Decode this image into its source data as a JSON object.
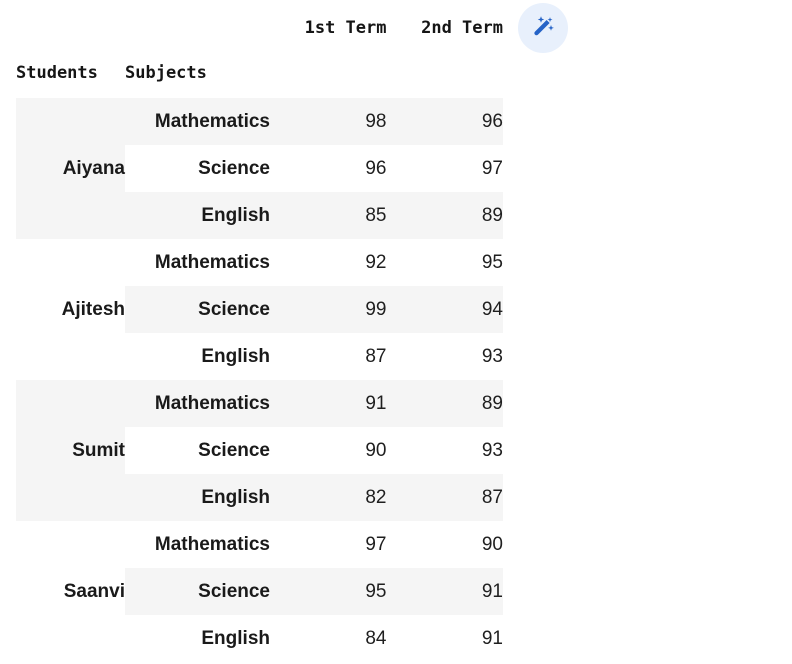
{
  "wand_button": {
    "icon": "magic-wand-icon",
    "label": "Magic wand",
    "circle_color": "#e8f0fc",
    "icon_color": "#2563c7"
  },
  "table": {
    "column_group_header": [
      "1st Term",
      "2nd Term"
    ],
    "index_names": {
      "students": "Students",
      "subjects": "Subjects"
    },
    "colors": {
      "shaded_row": "#f5f5f5",
      "plain_row": "#ffffff",
      "border": "#e3e3e3",
      "text": "#1a1a1a"
    },
    "groups": [
      {
        "student": "Aiyana",
        "band": "shaded",
        "rows": [
          {
            "subject": "Mathematics",
            "term1": "98",
            "term2": "96",
            "shade": "shaded"
          },
          {
            "subject": "Science",
            "term1": "96",
            "term2": "97",
            "shade": "plain"
          },
          {
            "subject": "English",
            "term1": "85",
            "term2": "89",
            "shade": "shaded"
          }
        ]
      },
      {
        "student": "Ajitesh",
        "band": "plain",
        "rows": [
          {
            "subject": "Mathematics",
            "term1": "92",
            "term2": "95",
            "shade": "plain"
          },
          {
            "subject": "Science",
            "term1": "99",
            "term2": "94",
            "shade": "shaded"
          },
          {
            "subject": "English",
            "term1": "87",
            "term2": "93",
            "shade": "plain"
          }
        ]
      },
      {
        "student": "Sumit",
        "band": "shaded",
        "rows": [
          {
            "subject": "Mathematics",
            "term1": "91",
            "term2": "89",
            "shade": "shaded"
          },
          {
            "subject": "Science",
            "term1": "90",
            "term2": "93",
            "shade": "plain"
          },
          {
            "subject": "English",
            "term1": "82",
            "term2": "87",
            "shade": "shaded"
          }
        ]
      },
      {
        "student": "Saanvi",
        "band": "plain",
        "rows": [
          {
            "subject": "Mathematics",
            "term1": "97",
            "term2": "90",
            "shade": "plain"
          },
          {
            "subject": "Science",
            "term1": "95",
            "term2": "91",
            "shade": "shaded"
          },
          {
            "subject": "English",
            "term1": "84",
            "term2": "91",
            "shade": "plain"
          }
        ]
      }
    ]
  }
}
